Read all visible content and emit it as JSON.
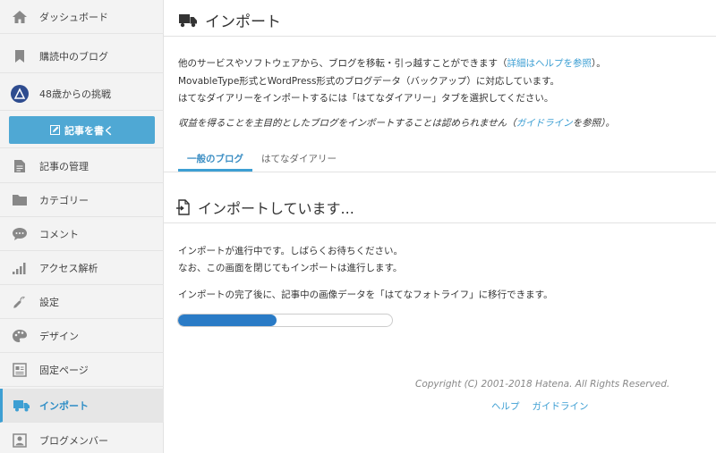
{
  "sidebar": {
    "items": [
      {
        "label": "ダッシュボード",
        "icon": "home-icon"
      },
      {
        "label": "購読中のブログ",
        "icon": "bookmark-icon"
      },
      {
        "label": "48歳からの挑戦",
        "icon": "blog-avatar"
      },
      {
        "label": "記事の管理",
        "icon": "document-icon"
      },
      {
        "label": "カテゴリー",
        "icon": "folder-icon"
      },
      {
        "label": "コメント",
        "icon": "speech-bubble-icon"
      },
      {
        "label": "アクセス解析",
        "icon": "bar-chart-icon"
      },
      {
        "label": "設定",
        "icon": "wrench-icon"
      },
      {
        "label": "デザイン",
        "icon": "palette-icon"
      },
      {
        "label": "固定ページ",
        "icon": "page-icon"
      },
      {
        "label": "インポート",
        "icon": "truck-icon"
      },
      {
        "label": "ブログメンバー",
        "icon": "person-icon"
      }
    ],
    "write_button": "記事を書く",
    "active_index": 10
  },
  "main": {
    "title": "インポート",
    "desc": {
      "line1_before": "他のサービスやソフトウェアから、ブログを移転・引っ越すことができます（",
      "line1_link": "詳細はヘルプを参照",
      "line1_after": "）。",
      "line2": "MovableType形式とWordPress形式のブログデータ（バックアップ）に対応しています。",
      "line3": "はてなダイアリーをインポートするには「はてなダイアリー」タブを選択してください。",
      "line4_before": "収益を得ることを主目的としたブログをインポートすることは認められません（",
      "line4_link": "ガイドライン",
      "line4_after": "を参照）。"
    },
    "tabs": [
      {
        "label": "一般のブログ",
        "active": true
      },
      {
        "label": "はてなダイアリー",
        "active": false
      }
    ],
    "status_title": "インポートしています...",
    "status_line1": "インポートが進行中です。しばらくお待ちください。",
    "status_line2": "なお、この画面を閉じてもインポートは進行します。",
    "status_line3": "インポートの完了後に、記事中の画像データを「はてなフォトライフ」に移行できます。",
    "progress": 0.46
  },
  "footer": {
    "copyright": "Copyright (C) 2001-2018 Hatena. All Rights Reserved.",
    "links": [
      "ヘルプ",
      "ガイドライン"
    ]
  },
  "colors": {
    "accent": "#3d9fd3",
    "button": "#4fa8d4",
    "progress": "#2a7bc6"
  }
}
